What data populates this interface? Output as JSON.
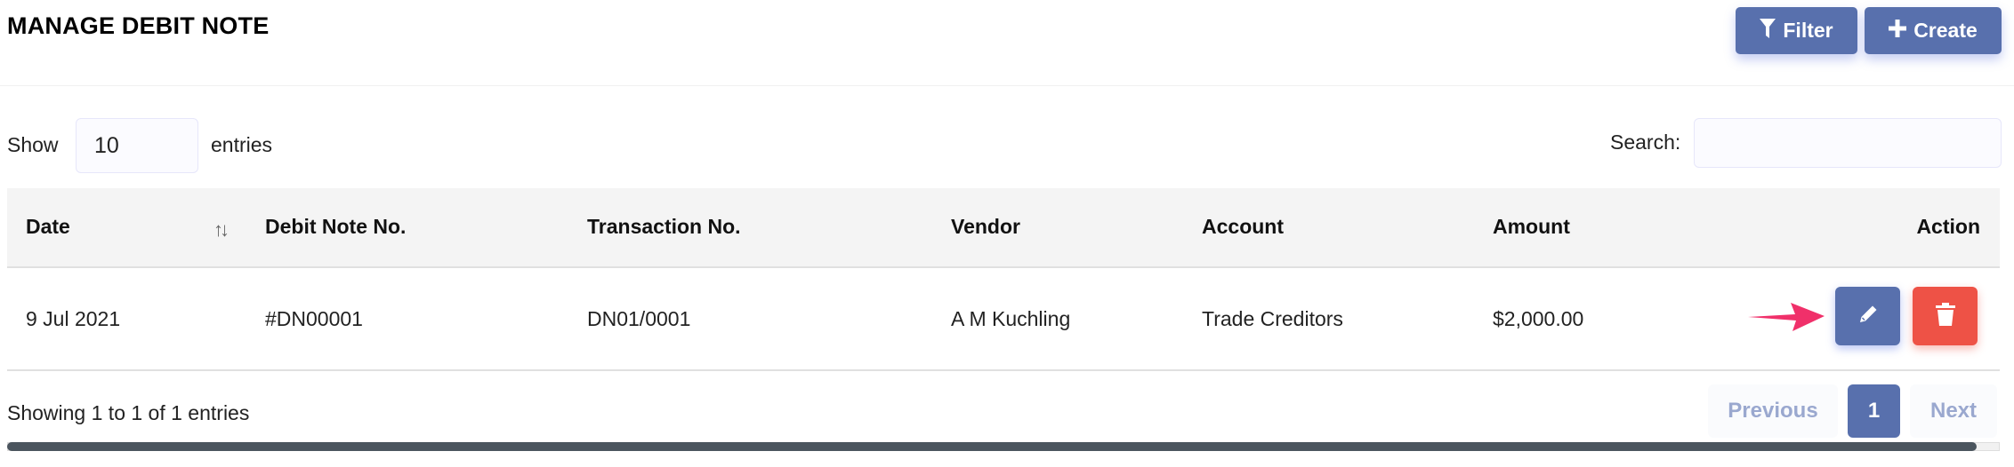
{
  "page": {
    "title": "MANAGE DEBIT NOTE"
  },
  "toolbar": {
    "filter_label": "Filter",
    "filter_icon": "filter-icon",
    "create_label": "Create",
    "create_icon": "plus-icon"
  },
  "length": {
    "show_label": "Show",
    "value": "10",
    "entries_label": "entries"
  },
  "search": {
    "label": "Search:",
    "value": "",
    "placeholder": ""
  },
  "table": {
    "columns": [
      "Date",
      "Debit Note No.",
      "Transaction No.",
      "Vendor",
      "Account",
      "Amount",
      "Action"
    ],
    "sort_icon": "sort-arrows-icon",
    "rows": [
      {
        "date": "9 Jul 2021",
        "debit_note_no": "#DN00001",
        "transaction_no": "DN01/0001",
        "vendor": "A M Kuchling",
        "account": "Trade Creditors",
        "amount": "$2,000.00",
        "actions": [
          "edit-icon",
          "trash-icon"
        ]
      }
    ]
  },
  "footer": {
    "info": "Showing 1 to 1 of 1 entries",
    "pagination": {
      "previous": "Previous",
      "current": "1",
      "next": "Next"
    }
  },
  "colors": {
    "primary": "#5870ad",
    "danger": "#ee5246",
    "annotation_arrow": "#f0306a"
  }
}
